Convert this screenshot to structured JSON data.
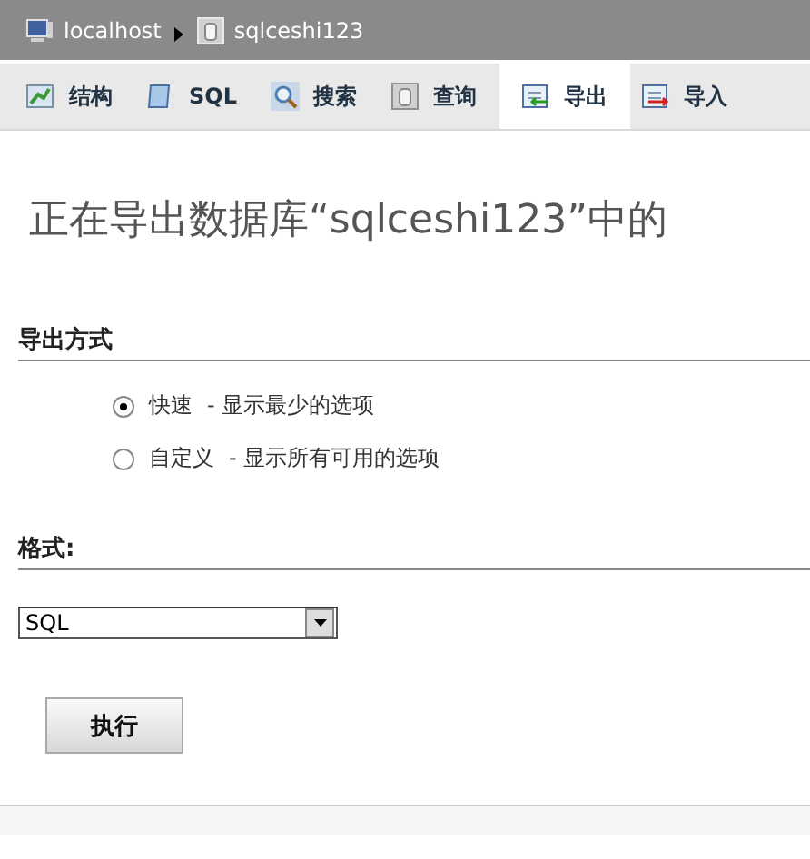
{
  "breadcrumb": [
    {
      "label": "localhost",
      "kind": "server"
    },
    {
      "label": "sqlceshi123",
      "kind": "database"
    }
  ],
  "tabs": [
    {
      "label": "结构",
      "kind": "structure",
      "selected": false
    },
    {
      "label": "SQL",
      "kind": "sql",
      "selected": false
    },
    {
      "label": "搜索",
      "kind": "search",
      "selected": false
    },
    {
      "label": "查询",
      "kind": "query",
      "selected": false
    },
    {
      "label": "导出",
      "kind": "export",
      "selected": true
    },
    {
      "label": "导入",
      "kind": "import",
      "selected": false
    }
  ],
  "title": "正在导出数据库“sqlceshi123”中的",
  "method": {
    "heading": "导出方式",
    "options": [
      {
        "label": "快速",
        "hint": "- 显示最少的选项",
        "selected": true
      },
      {
        "label": "自定义",
        "hint": "- 显示所有可用的选项",
        "selected": false
      }
    ]
  },
  "format": {
    "heading": "格式:",
    "value": "SQL"
  },
  "submit": "执行"
}
